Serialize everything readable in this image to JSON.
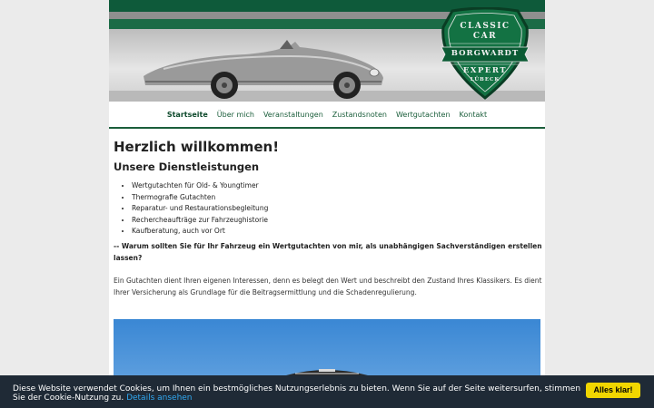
{
  "header": {
    "badge": {
      "line1": "CLASSIC",
      "line2": "CAR",
      "ribbon": "BORGWARDT",
      "line3": "EXPERT",
      "line4": "LÜBECK"
    }
  },
  "nav": {
    "items": [
      {
        "label": "Startseite",
        "active": true
      },
      {
        "label": "Über mich"
      },
      {
        "label": "Veranstaltungen"
      },
      {
        "label": "Zustandsnoten"
      },
      {
        "label": "Wertgutachten"
      },
      {
        "label": "Kontakt"
      }
    ]
  },
  "main": {
    "title": "Herzlich willkommen!",
    "subtitle": "Unsere Dienstleistungen",
    "services": [
      "Wertgutachten für Old- & Youngtimer",
      "Thermografie Gutachten",
      "Reparatur- und Restaurationsbegleitung",
      "Rechercheaufträge zur Fahrzeughistorie",
      "Kaufberatung, auch vor Ort"
    ],
    "question": "-- Warum sollten Sie für Ihr Fahrzeug ein Wertgutachten von mir, als unabhängigen Sachverständigen erstellen lassen?",
    "paragraph": "Ein Gutachten dient Ihren eigenen Interessen, denn es belegt den Wert und beschreibt den Zustand Ihres Klassikers. Es dient Ihrer Versicherung als Grundlage für die Beitragsermittlung und die Schadenregulierung."
  },
  "cookie": {
    "message": "Diese Website verwendet Cookies, um Ihnen ein bestmögliches Nutzungserlebnis zu bieten. Wenn Sie auf der Seite weitersurfen, stimmen Sie der Cookie-Nutzung zu.",
    "link": "Details ansehen",
    "accept": "Alles klar!"
  },
  "colors": {
    "brand_green": "#1b5e3b",
    "cookie_bg": "#1f2a36",
    "cookie_button": "#f1d600",
    "link_blue": "#31a8f0"
  }
}
